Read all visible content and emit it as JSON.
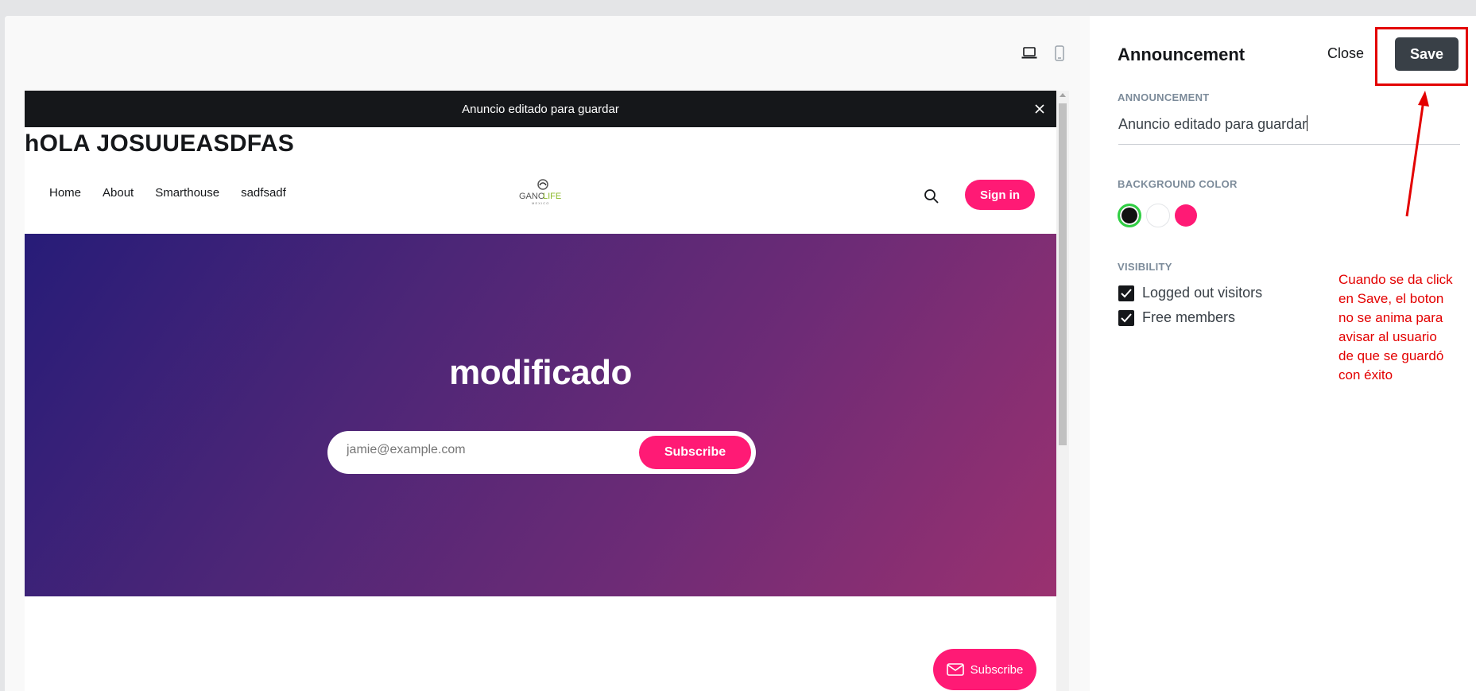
{
  "preview": {
    "device_icons": [
      "laptop-icon",
      "mobile-icon"
    ],
    "announcement_bar": {
      "text": "Anuncio editado para guardar"
    },
    "site": {
      "title": "hOLA JOSUUEASDFAS",
      "nav": [
        "Home",
        "About",
        "Smarthouse",
        "sadfsadf"
      ],
      "logo_alt": "GANOLIFE",
      "signin_label": "Sign in",
      "hero_title": "modificado",
      "email_placeholder": "jamie@example.com",
      "subscribe_label": "Subscribe",
      "portal_label": "Subscribe"
    }
  },
  "panel": {
    "title": "Announcement",
    "close_label": "Close",
    "save_label": "Save",
    "announcement_label": "ANNOUNCEMENT",
    "announcement_value": "Anuncio editado para guardar",
    "bg_color_label": "BACKGROUND COLOR",
    "colors": [
      "#111111",
      "#ffffff",
      "#ff1a75"
    ],
    "selected_color": "#111111",
    "visibility_label": "VISIBILITY",
    "visibility_options": [
      {
        "label": "Logged out visitors",
        "checked": true
      },
      {
        "label": "Free members",
        "checked": true
      }
    ]
  },
  "annotation": {
    "note_lines": [
      "Cuando se da click",
      "en Save, el boton",
      "no se anima para",
      "avisar al usuario",
      "de que se guardó",
      "con éxito"
    ],
    "color": "#e30000"
  }
}
